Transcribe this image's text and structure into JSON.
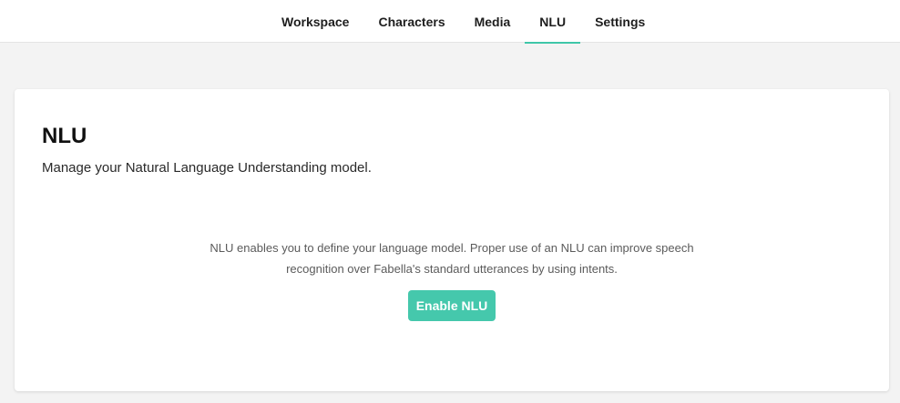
{
  "nav": {
    "tabs": [
      {
        "label": "Workspace"
      },
      {
        "label": "Characters"
      },
      {
        "label": "Media"
      },
      {
        "label": "NLU"
      },
      {
        "label": "Settings"
      }
    ],
    "active_tab": "NLU",
    "accent_color": "#3fc6a8"
  },
  "card": {
    "title": "NLU",
    "subtitle": "Manage your Natural Language Understanding model.",
    "description": "NLU enables you to define your language model. Proper use of an NLU can improve speech recognition over Fabella's standard utterances by using intents.",
    "enable_button_label": "Enable NLU",
    "button_color": "#45c8ac"
  }
}
